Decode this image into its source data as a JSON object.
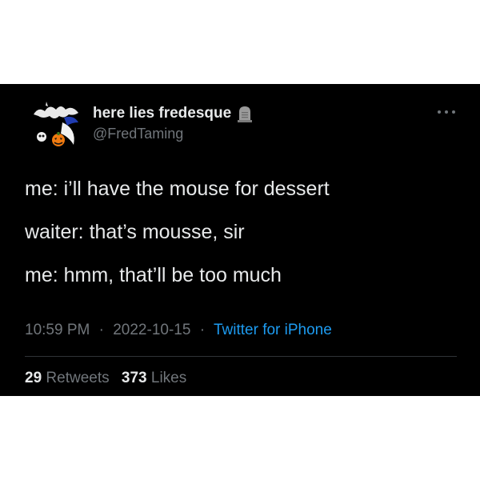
{
  "user": {
    "display_name": "here lies fredesque",
    "handle": "@FredTaming",
    "name_icon": "tombstone-icon",
    "avatar_icon": "avatar-image"
  },
  "tweet": {
    "lines": [
      "me: i’ll have the mouse for dessert",
      "waiter: that’s mousse, sir",
      "me: hmm, that’ll be too much"
    ],
    "time": "10:59 PM",
    "date": "2022-10-15",
    "separator": "·",
    "source": "Twitter for iPhone"
  },
  "stats": {
    "retweets_count": "29",
    "retweets_label": "Retweets",
    "likes_count": "373",
    "likes_label": "Likes"
  },
  "menu": {
    "more_icon": "more-options-icon"
  },
  "colors": {
    "background": "#000000",
    "text_primary": "#e7e9ea",
    "text_secondary": "#71767b",
    "accent": "#1d9bf0",
    "divider": "#2f3336"
  }
}
